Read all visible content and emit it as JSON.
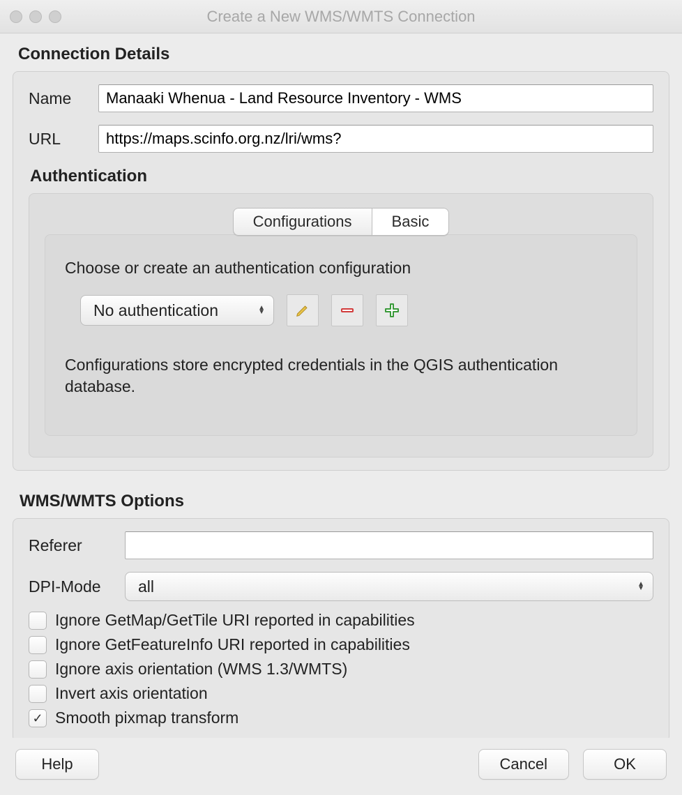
{
  "window": {
    "title": "Create a New WMS/WMTS Connection"
  },
  "connectionDetails": {
    "title": "Connection Details",
    "nameLabel": "Name",
    "nameValue": "Manaaki Whenua - Land Resource Inventory - WMS",
    "urlLabel": "URL",
    "urlValue": "https://maps.scinfo.org.nz/lri/wms?"
  },
  "authentication": {
    "title": "Authentication",
    "tabs": {
      "configurations": "Configurations",
      "basic": "Basic"
    },
    "chooseText": "Choose or create an authentication configuration",
    "selected": "No authentication",
    "note": "Configurations store encrypted credentials in the QGIS authentication database."
  },
  "options": {
    "title": "WMS/WMTS Options",
    "refererLabel": "Referer",
    "refererValue": "",
    "dpiLabel": "DPI-Mode",
    "dpiValue": "all",
    "checks": [
      {
        "label": "Ignore GetMap/GetTile URI reported in capabilities",
        "checked": false
      },
      {
        "label": "Ignore GetFeatureInfo URI reported in capabilities",
        "checked": false
      },
      {
        "label": "Ignore axis orientation (WMS 1.3/WMTS)",
        "checked": false
      },
      {
        "label": "Invert axis orientation",
        "checked": false
      },
      {
        "label": "Smooth pixmap transform",
        "checked": true
      }
    ]
  },
  "buttons": {
    "help": "Help",
    "cancel": "Cancel",
    "ok": "OK"
  }
}
